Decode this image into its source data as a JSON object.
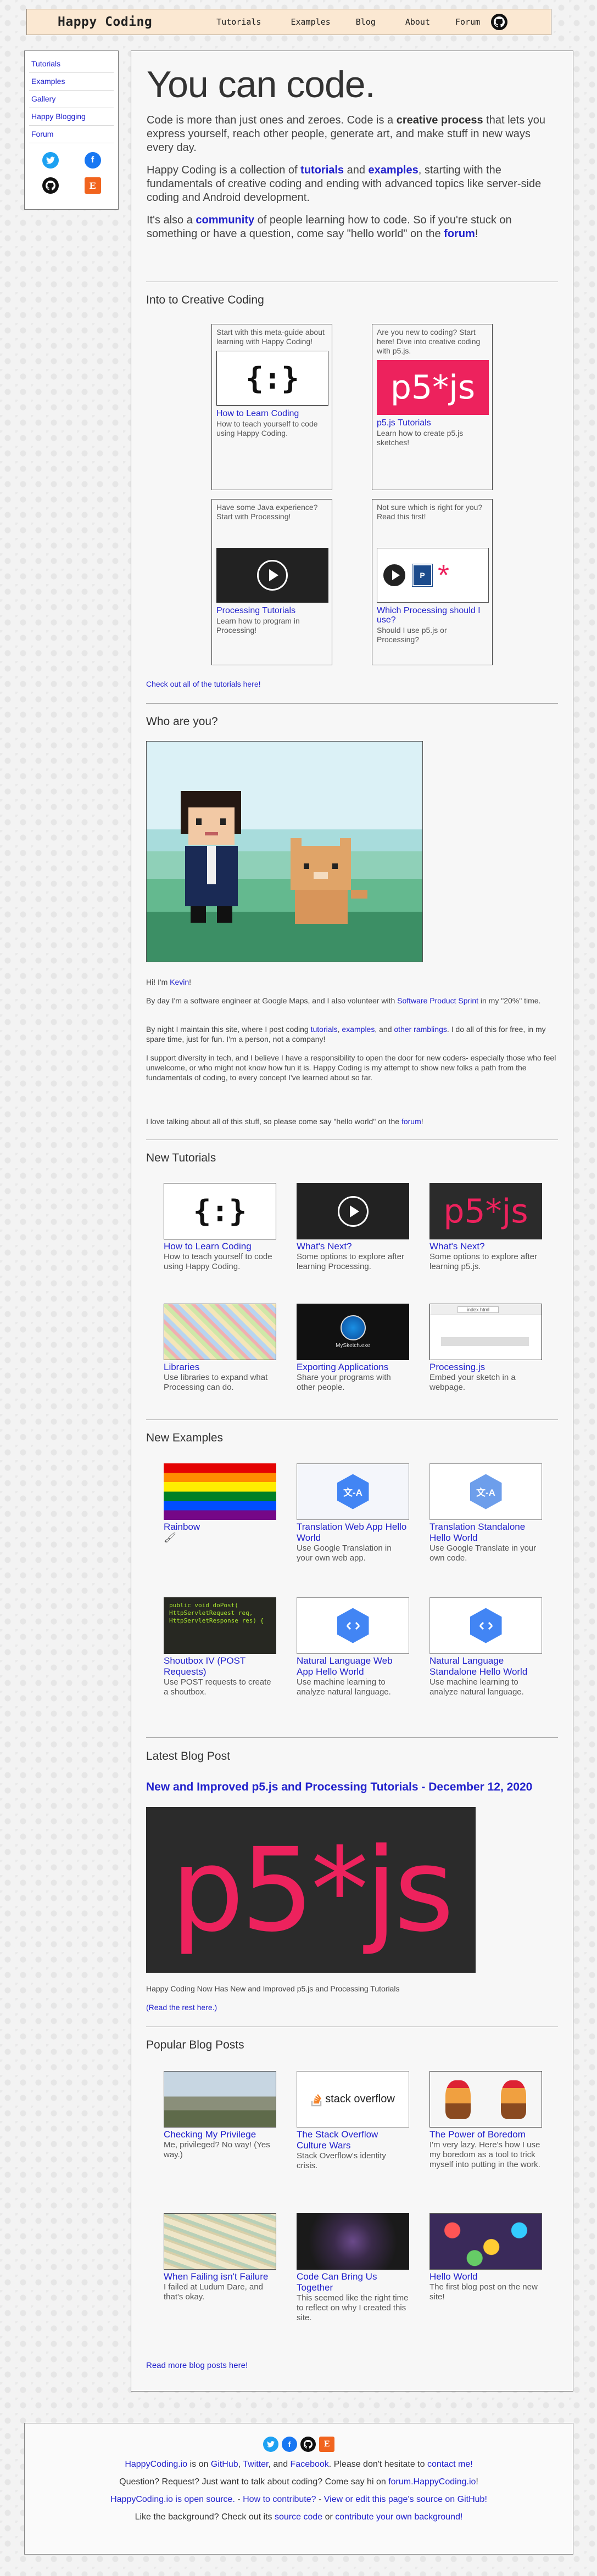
{
  "header": {
    "site_title": "Happy Coding",
    "nav": [
      "Tutorials",
      "Examples",
      "Blog",
      "About",
      "Forum"
    ]
  },
  "sidebar": {
    "items": [
      "Tutorials",
      "Examples",
      "Gallery",
      "Happy Blogging",
      "Forum"
    ],
    "social_icons": [
      "twitter-icon",
      "facebook-icon",
      "github-icon",
      "etsy-icon"
    ]
  },
  "hero": {
    "title": "You can code.",
    "p1_a": "Code is more than just ones and zeroes. Code is a ",
    "p1_b": "creative process",
    "p1_c": " that lets you express yourself, reach other people, generate art, and make stuff in new ways every day.",
    "p2_a": "Happy Coding is a collection of ",
    "p2_link1": "tutorials",
    "p2_and": " and ",
    "p2_link2": "examples",
    "p2_c": ", starting with the fundamentals of creative coding and ending with advanced topics like server-side coding and Android development.",
    "p3_a": "It's also a ",
    "p3_link1": "community",
    "p3_b": " of people learning how to code. So if you're stuck on something or have a question, come say \"hello world\" on the ",
    "p3_link2": "forum",
    "p3_c": "!"
  },
  "into_creative": {
    "title": "Into to Creative Coding",
    "cards": [
      {
        "desc": "Start with this meta-guide about learning with Happy Coding!",
        "title": "How to Learn Coding",
        "sub": "How to teach yourself to code using Happy Coding."
      },
      {
        "desc": "Are you new to coding? Start here! Dive into creative coding with p5.js.",
        "title": "p5.js Tutorials",
        "sub": "Learn how to create p5.js sketches!"
      },
      {
        "desc": "Have some Java experience? Start with Processing!",
        "title": "Processing Tutorials",
        "sub": "Learn how to program in Processing!"
      },
      {
        "desc": "Not sure which is right for you? Read this first!",
        "title": "Which Processing should I use?",
        "sub": "Should I use p5.js or Processing?"
      }
    ],
    "check_all": "Check out all of the tutorials here!"
  },
  "who": {
    "title": "Who are you?",
    "hi_a": "Hi! I'm ",
    "hi_link": "Kevin",
    "hi_b": "!",
    "p1_a": "By day I'm a software engineer at Google Maps, and I also volunteer with ",
    "p1_link": "Software Product Sprint",
    "p1_b": " in my \"20%\" time.",
    "p2_a": "By night I maintain this site, where I post coding ",
    "p2_l1": "tutorials",
    "p2_l2": "examples",
    "p2_l3": "other ramblings",
    "p2_b": ". I do all of this for free, in my spare time, just for fun. I'm a person, not a company!",
    "p3": "I support diversity in tech, and I believe I have a responsibility to open the door for new coders- especially those who feel unwelcome, or who might not know how fun it is. Happy Coding is my attempt to show new folks a path from the fundamentals of coding, to every concept I've learned about so far.",
    "p4_a": "I love talking about all of this stuff, so please come say \"hello world\" on the ",
    "p4_link": "forum",
    "p4_b": "!"
  },
  "new_tutorials": {
    "title": "New Tutorials",
    "cards": [
      {
        "title": "How to Learn Coding",
        "sub": "How to teach yourself to code using Happy Coding."
      },
      {
        "title": "What's Next?",
        "sub": "Some options to explore after learning Processing."
      },
      {
        "title": "What's Next?",
        "sub": "Some options to explore after learning p5.js."
      },
      {
        "title": "Libraries",
        "sub": "Use libraries to expand what Processing can do."
      },
      {
        "title": "Exporting Applications",
        "sub": "Share your programs with other people."
      },
      {
        "title": "Processing.js",
        "sub": "Embed your sketch in a webpage."
      }
    ]
  },
  "new_examples": {
    "title": "New Examples",
    "cards": [
      {
        "title": "Rainbow",
        "sub": ""
      },
      {
        "title": "Translation Web App Hello World",
        "sub": "Use Google Translation in your own web app."
      },
      {
        "title": "Translation Standalone Hello World",
        "sub": "Use Google Translate in your own code."
      },
      {
        "title": "Shoutbox IV (POST Requests)",
        "sub": "Use POST requests to create a shoutbox."
      },
      {
        "title": "Natural Language Web App Hello World",
        "sub": "Use machine learning to analyze natural language."
      },
      {
        "title": "Natural Language Standalone Hello World",
        "sub": "Use machine learning to analyze natural language."
      }
    ]
  },
  "latest_blog": {
    "title": "Latest Blog Post",
    "post_title": "New and Improved p5.js and Processing Tutorials - December 12, 2020",
    "caption": "Happy Coding Now Has New and Improved p5.js and Processing Tutorials",
    "read_more": "(Read the rest here.)"
  },
  "popular": {
    "title": "Popular Blog Posts",
    "cards": [
      {
        "title": "Checking My Privilege",
        "sub": "Me, privileged? No way! (Yes way.)"
      },
      {
        "title": "The Stack Overflow Culture Wars",
        "sub": "Stack Overflow's identity crisis."
      },
      {
        "title": "The Power of Boredom",
        "sub": "I'm very lazy. Here's how I use my boredom as a tool to trick myself into putting in the work."
      },
      {
        "title": "When Failing isn't Failure",
        "sub": "I failed at Ludum Dare, and that's okay."
      },
      {
        "title": "Code Can Bring Us Together",
        "sub": "This seemed like the right time to reflect on why I created this site."
      },
      {
        "title": "Hello World",
        "sub": "The first blog post on the new site!"
      }
    ],
    "more": "Read more blog posts here!"
  },
  "images": {
    "brace_glyph": "{:}",
    "p5_text": "p5*js",
    "p5_big_text": "p5*js",
    "translate_glyph": "文-A",
    "so_text": "stack overflow",
    "code_lines": [
      "public void doPost(",
      "  HttpServletRequest req,",
      "  HttpServletResponse res) {"
    ],
    "browser_url": "index.html",
    "mysketch_label": "MySketch.exe"
  },
  "footer": {
    "line1_a": "HappyCoding.io",
    "line1_b": " is on ",
    "line1_l1": "GitHub",
    "line1_l2": "Twitter",
    "line1_and": ", and ",
    "line1_l3": "Facebook",
    "line1_c": ". Please don't hesitate to ",
    "line1_l4": "contact me!",
    "line2_a": "Question? Request? Just want to talk about coding? Come say hi on ",
    "line2_l": "forum.HappyCoding.io",
    "line2_b": "!",
    "line3_l1": "HappyCoding.io is open source.",
    "line3_sep1": " - ",
    "line3_l2": "How to contribute?",
    "line3_sep2": " - ",
    "line3_l3": "View or edit this page's source on GitHub!",
    "line4_a": "Like the background? Check out its ",
    "line4_l1": "source code",
    "line4_b": " or ",
    "line4_l2": "contribute your own background!"
  },
  "colors": {
    "link": "#2222cc",
    "header_bg": "#fbe8d2",
    "p5_pink": "#ed225d"
  }
}
